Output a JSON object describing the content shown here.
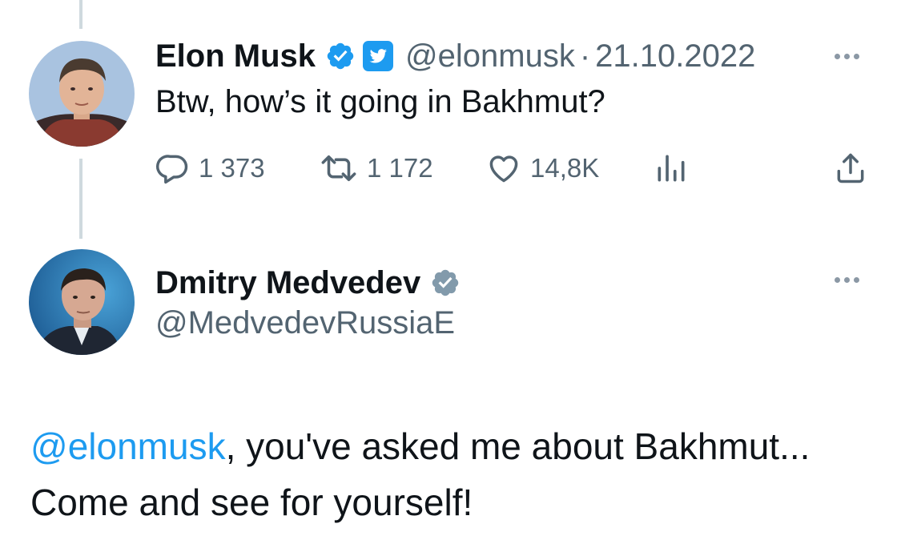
{
  "colors": {
    "verified": "#1d9bf0",
    "link": "#1d9bf0",
    "secondary_text": "#536471",
    "thread_line": "#cfd9de"
  },
  "tweet1": {
    "avatar_icon": "avatar-elon-musk",
    "name": "Elon Musk",
    "handle": "@elonmusk",
    "separator": "·",
    "date": "21.10.2022",
    "text": "Btw, how’s it going in Bakhmut?",
    "stats": {
      "replies": "1 373",
      "retweets": "1 172",
      "likes": "14,8K"
    },
    "icons": [
      "verified-badge-icon",
      "twitter-bird-badge-icon",
      "more-icon",
      "reply-icon",
      "retweet-icon",
      "like-icon",
      "views-icon",
      "share-icon"
    ]
  },
  "tweet2": {
    "avatar_icon": "avatar-dmitry-medvedev",
    "name": "Dmitry Medvedev",
    "handle": "@MedvedevRussiaE",
    "mention": "@elonmusk",
    "text_after_mention": ", you've asked me about Bakhmut... Come and see for yourself!",
    "icons": [
      "verified-badge-icon",
      "more-icon"
    ]
  }
}
